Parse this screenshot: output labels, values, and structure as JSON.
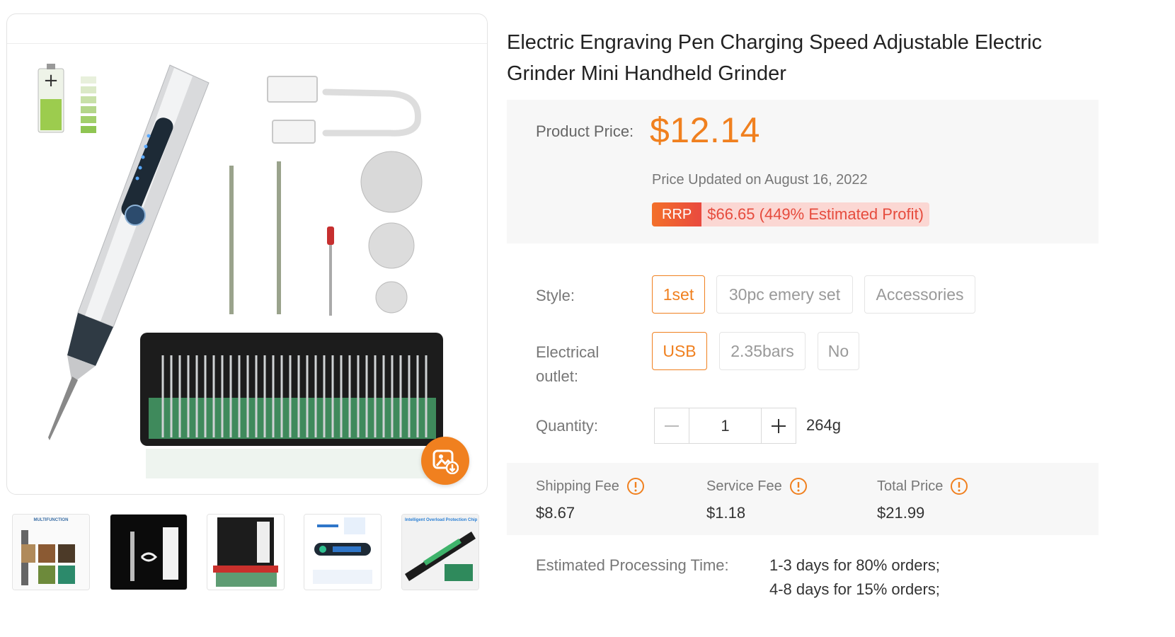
{
  "product": {
    "title": "Electric Engraving Pen Charging Speed Adjustable Electric Grinder Mini Handheld Grinder"
  },
  "gallery": {
    "download_icon": "image-download-icon",
    "thumbnails": [
      {
        "caption": "MULTIFUNCTION"
      },
      {
        "caption": ""
      },
      {
        "caption": ""
      },
      {
        "caption": ""
      },
      {
        "caption": "Intelligent Overload Protection Chip"
      }
    ]
  },
  "pricing": {
    "label": "Product Price:",
    "price": "$12.14",
    "updated": "Price Updated on August 16, 2022",
    "rrp_tag": "RRP",
    "rrp_text": "$66.65 (449% Estimated Profit)"
  },
  "options": {
    "style": {
      "label": "Style:",
      "choices": [
        "1set",
        "30pc emery set",
        "Accessories"
      ],
      "selected": "1set"
    },
    "outlet": {
      "label_line1": "Electrical",
      "label_line2": "outlet:",
      "choices": [
        "USB",
        "2.35bars",
        "No"
      ],
      "selected": "USB"
    },
    "quantity": {
      "label": "Quantity:",
      "value": "1",
      "weight": "264g"
    }
  },
  "fees": {
    "shipping": {
      "label": "Shipping Fee",
      "value": "$8.67"
    },
    "service": {
      "label": "Service Fee",
      "value": "$1.18"
    },
    "total": {
      "label": "Total Price",
      "value": "$21.99"
    }
  },
  "processing": {
    "label": "Estimated Processing Time:",
    "lines": [
      "1-3 days for 80% orders;",
      "4-8 days for 15% orders;"
    ]
  },
  "colors": {
    "accent": "#f0801f",
    "rrp_red": "#e64b3d",
    "panel_bg": "#f7f7f7"
  }
}
